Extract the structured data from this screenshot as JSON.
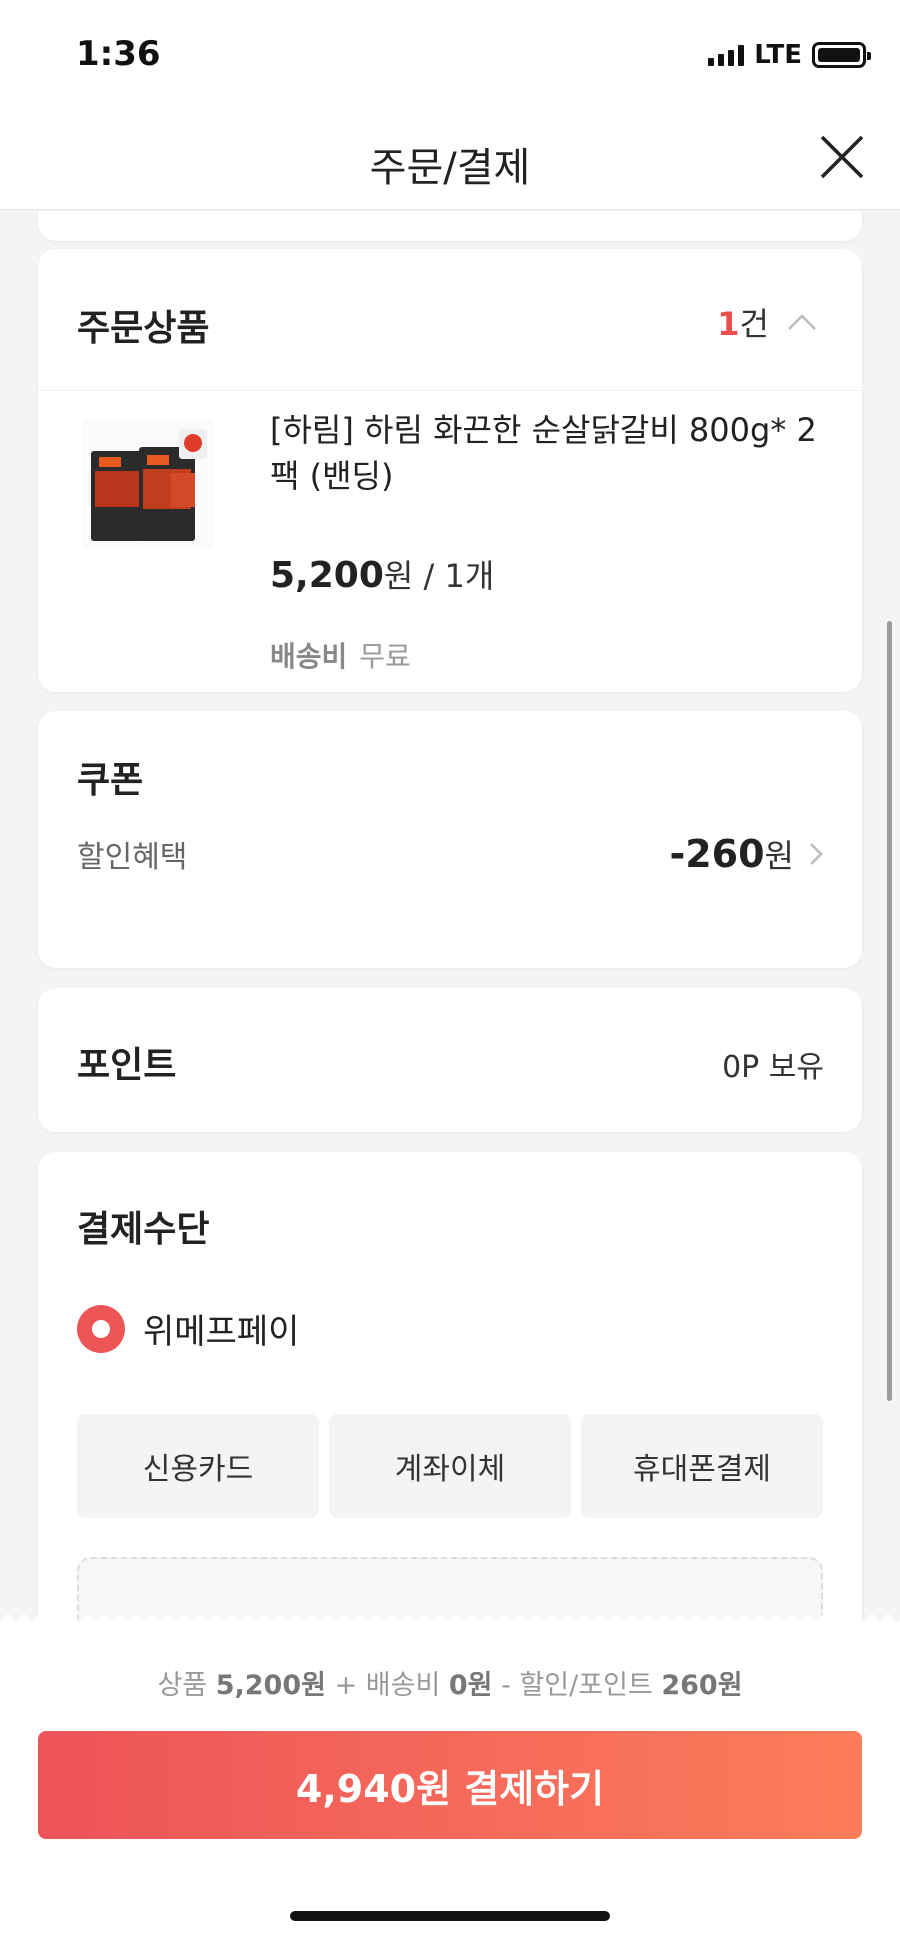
{
  "status_bar": {
    "time": "1:36",
    "network": "LTE"
  },
  "header": {
    "title": "주문/결제"
  },
  "order_products": {
    "title": "주문상품",
    "count_number": "1",
    "count_unit": "건",
    "product": {
      "name": "[하림] 하림 화끈한 순살닭갈비 800g* 2팩 (밴딩)",
      "price": "5,200",
      "price_unit": "원",
      "quantity": " / 1개",
      "shipping_label": "배송비",
      "shipping_value": "무료",
      "image_icon": "product-package-image"
    }
  },
  "coupon": {
    "title": "쿠폰",
    "label": "할인혜택",
    "amount": "-260",
    "unit": "원"
  },
  "points": {
    "title": "포인트",
    "holding": "0P 보유"
  },
  "payment": {
    "title": "결제수단",
    "selected_method": "위메프페이",
    "methods": [
      "신용카드",
      "계좌이체",
      "휴대폰결제"
    ]
  },
  "summary": {
    "product_label": "상품",
    "product_amount": "5,200원",
    "shipping_label": "+ 배송비",
    "shipping_amount": "0원",
    "discount_label": "- 할인/포인트",
    "discount_amount": "260원"
  },
  "pay_button": {
    "label": "4,940원 결제하기"
  },
  "colors": {
    "accent": "#ec4e4e",
    "gradient_start": "#ec5459",
    "gradient_end": "#fd7d5a"
  }
}
